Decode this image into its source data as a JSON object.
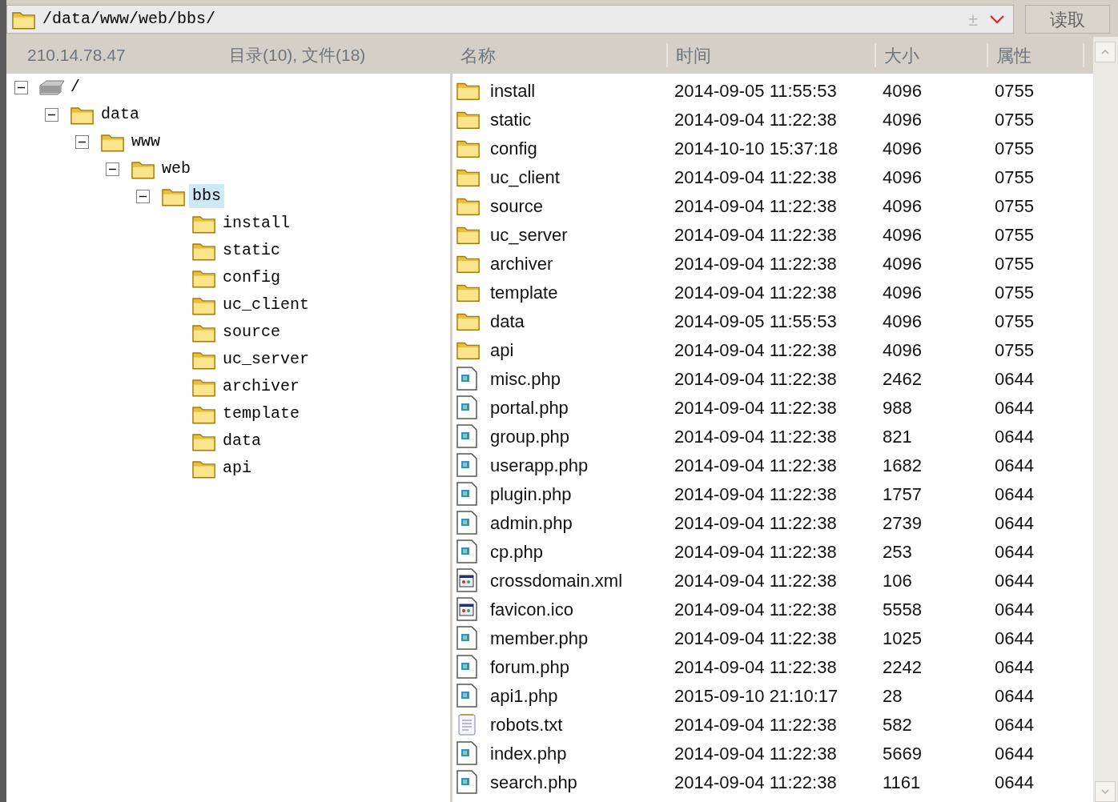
{
  "path_bar": {
    "value": "/data/www/web/bbs/",
    "plus_glyph": "±",
    "read_button": "读取"
  },
  "tree_header": {
    "host": "210.14.78.47",
    "counts": "目录(10), 文件(18)"
  },
  "columns": [
    "名称",
    "时间",
    "大小",
    "属性"
  ],
  "tree": [
    {
      "label": "/",
      "kind": "drive",
      "expanded": true,
      "selected": false,
      "children": [
        {
          "label": "data",
          "kind": "folder",
          "expanded": true,
          "selected": false,
          "children": [
            {
              "label": "www",
              "kind": "folder",
              "expanded": true,
              "selected": false,
              "children": [
                {
                  "label": "web",
                  "kind": "folder",
                  "expanded": true,
                  "selected": false,
                  "children": [
                    {
                      "label": "bbs",
                      "kind": "folder",
                      "expanded": true,
                      "selected": true,
                      "children": [
                        {
                          "label": "install",
                          "kind": "folder",
                          "selected": false
                        },
                        {
                          "label": "static",
                          "kind": "folder",
                          "selected": false
                        },
                        {
                          "label": "config",
                          "kind": "folder",
                          "selected": false
                        },
                        {
                          "label": "uc_client",
                          "kind": "folder",
                          "selected": false
                        },
                        {
                          "label": "source",
                          "kind": "folder",
                          "selected": false
                        },
                        {
                          "label": "uc_server",
                          "kind": "folder",
                          "selected": false
                        },
                        {
                          "label": "archiver",
                          "kind": "folder",
                          "selected": false
                        },
                        {
                          "label": "template",
                          "kind": "folder",
                          "selected": false
                        },
                        {
                          "label": "data",
                          "kind": "folder",
                          "selected": false
                        },
                        {
                          "label": "api",
                          "kind": "folder",
                          "selected": false
                        }
                      ]
                    }
                  ]
                }
              ]
            }
          ]
        }
      ]
    }
  ],
  "files": [
    {
      "kind": "folder",
      "name": "install",
      "time": "2014-09-05 11:55:53",
      "size": "4096",
      "mode": "0755"
    },
    {
      "kind": "folder",
      "name": "static",
      "time": "2014-09-04 11:22:38",
      "size": "4096",
      "mode": "0755"
    },
    {
      "kind": "folder",
      "name": "config",
      "time": "2014-10-10 15:37:18",
      "size": "4096",
      "mode": "0755"
    },
    {
      "kind": "folder",
      "name": "uc_client",
      "time": "2014-09-04 11:22:38",
      "size": "4096",
      "mode": "0755"
    },
    {
      "kind": "folder",
      "name": "source",
      "time": "2014-09-04 11:22:38",
      "size": "4096",
      "mode": "0755"
    },
    {
      "kind": "folder",
      "name": "uc_server",
      "time": "2014-09-04 11:22:38",
      "size": "4096",
      "mode": "0755"
    },
    {
      "kind": "folder",
      "name": "archiver",
      "time": "2014-09-04 11:22:38",
      "size": "4096",
      "mode": "0755"
    },
    {
      "kind": "folder",
      "name": "template",
      "time": "2014-09-04 11:22:38",
      "size": "4096",
      "mode": "0755"
    },
    {
      "kind": "folder",
      "name": "data",
      "time": "2014-09-05 11:55:53",
      "size": "4096",
      "mode": "0755"
    },
    {
      "kind": "folder",
      "name": "api",
      "time": "2014-09-04 11:22:38",
      "size": "4096",
      "mode": "0755"
    },
    {
      "kind": "script",
      "name": "misc.php",
      "time": "2014-09-04 11:22:38",
      "size": "2462",
      "mode": "0644"
    },
    {
      "kind": "script",
      "name": "portal.php",
      "time": "2014-09-04 11:22:38",
      "size": "988",
      "mode": "0644"
    },
    {
      "kind": "script",
      "name": "group.php",
      "time": "2014-09-04 11:22:38",
      "size": "821",
      "mode": "0644"
    },
    {
      "kind": "script",
      "name": "userapp.php",
      "time": "2014-09-04 11:22:38",
      "size": "1682",
      "mode": "0644"
    },
    {
      "kind": "script",
      "name": "plugin.php",
      "time": "2014-09-04 11:22:38",
      "size": "1757",
      "mode": "0644"
    },
    {
      "kind": "script",
      "name": "admin.php",
      "time": "2014-09-04 11:22:38",
      "size": "2739",
      "mode": "0644"
    },
    {
      "kind": "script",
      "name": "cp.php",
      "time": "2014-09-04 11:22:38",
      "size": "253",
      "mode": "0644"
    },
    {
      "kind": "window",
      "name": "crossdomain.xml",
      "time": "2014-09-04 11:22:38",
      "size": "106",
      "mode": "0644"
    },
    {
      "kind": "window",
      "name": "favicon.ico",
      "time": "2014-09-04 11:22:38",
      "size": "5558",
      "mode": "0644"
    },
    {
      "kind": "script",
      "name": "member.php",
      "time": "2014-09-04 11:22:38",
      "size": "1025",
      "mode": "0644"
    },
    {
      "kind": "script",
      "name": "forum.php",
      "time": "2014-09-04 11:22:38",
      "size": "2242",
      "mode": "0644"
    },
    {
      "kind": "script",
      "name": "api1.php",
      "time": "2015-09-10 21:10:17",
      "size": "28",
      "mode": "0644"
    },
    {
      "kind": "text",
      "name": "robots.txt",
      "time": "2014-09-04 11:22:38",
      "size": "582",
      "mode": "0644"
    },
    {
      "kind": "script",
      "name": "index.php",
      "time": "2014-09-04 11:22:38",
      "size": "5669",
      "mode": "0644"
    },
    {
      "kind": "script",
      "name": "search.php",
      "time": "2014-09-04 11:22:38",
      "size": "1161",
      "mode": "0644"
    }
  ]
}
